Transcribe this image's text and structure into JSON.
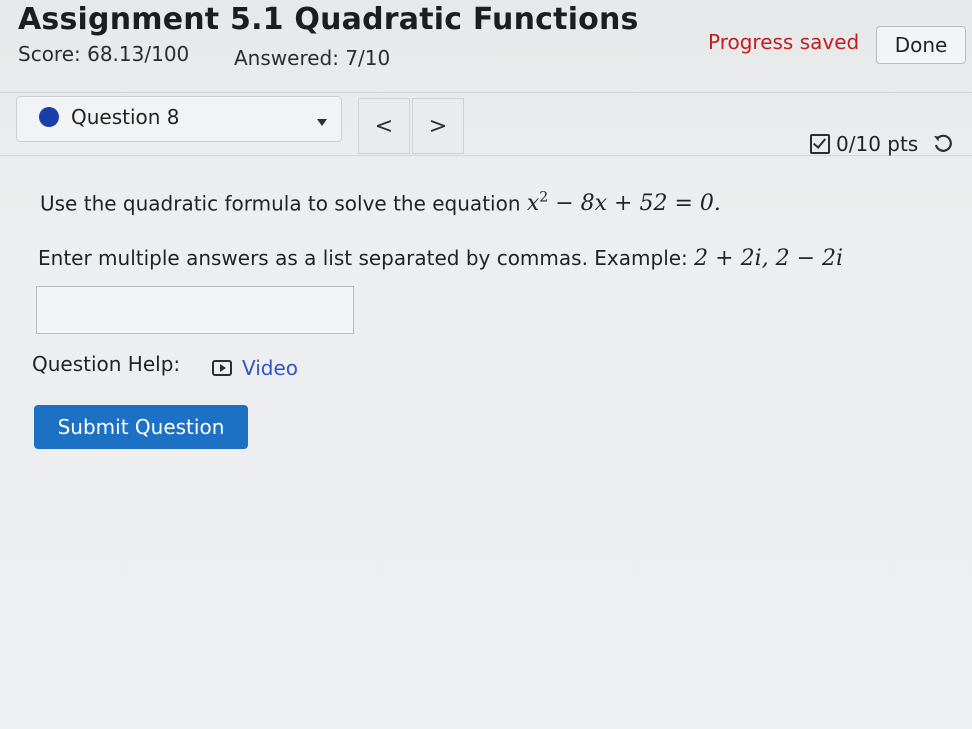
{
  "header": {
    "title": "Assignment 5.1 Quadratic Functions",
    "score": "Score: 68.13/100",
    "answered": "Answered: 7/10",
    "status": "Progress saved",
    "done_label": "Done"
  },
  "question_nav": {
    "current": "Question 8",
    "prev_label": "<",
    "next_label": ">",
    "points": "0/10 pts"
  },
  "question": {
    "prompt": "Use the quadratic formula to solve the equation",
    "equation": {
      "lhs_var": "x",
      "exponent": "2",
      "rest": "− 8x + 52 = 0."
    },
    "instruction": "Enter multiple answers as a list separated by commas. Example:",
    "example": "2 + 2i, 2 − 2i",
    "answer_value": "",
    "help_label": "Question Help:",
    "video_label": "Video",
    "submit_label": "Submit Question"
  },
  "colors": {
    "accent": "#1d71c4",
    "status_red": "#c21e1e",
    "link_blue": "#2f55c8",
    "question_dot": "#1a3fa8"
  },
  "icons": {
    "dropdown": "chevron-down-icon",
    "points": "checkbox-icon",
    "retry": "retry-icon",
    "video": "video-icon"
  }
}
